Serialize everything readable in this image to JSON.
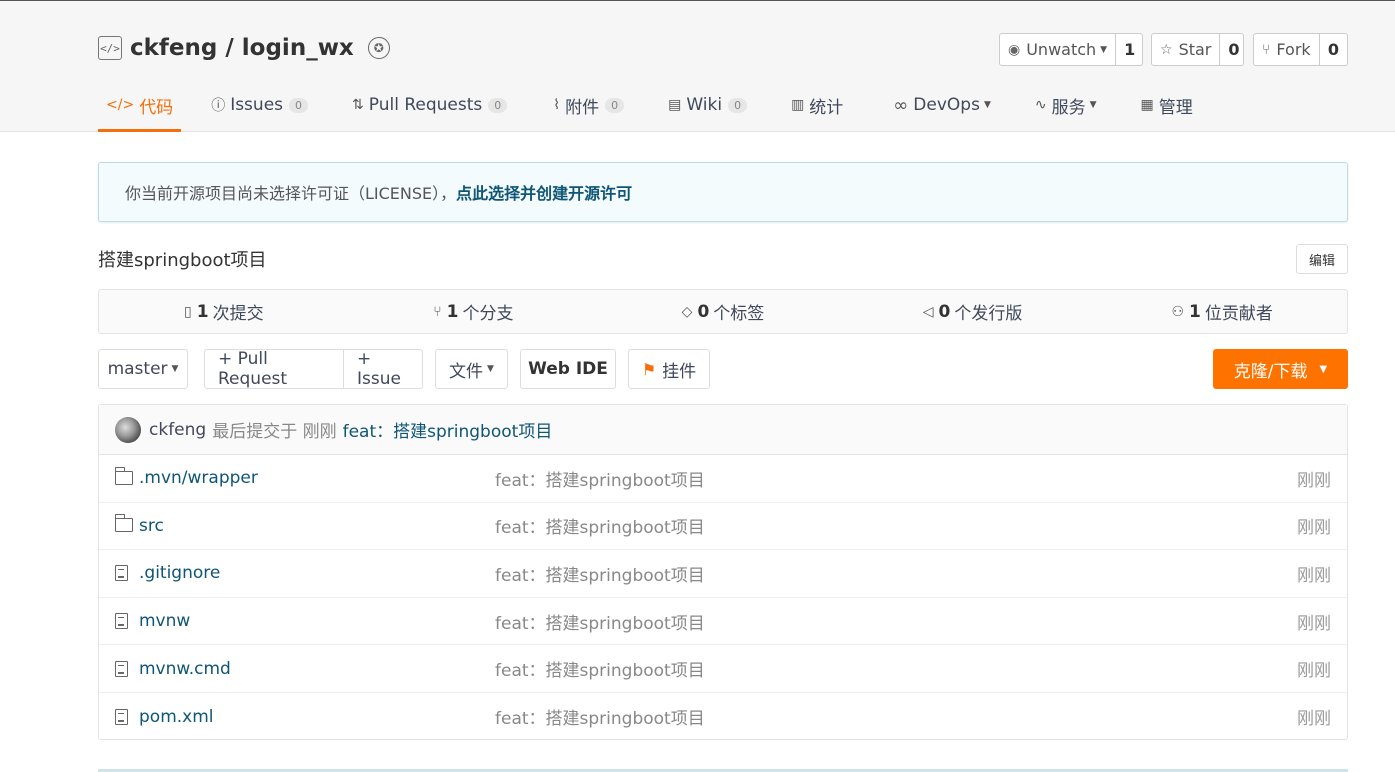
{
  "repo": {
    "owner": "ckfeng",
    "separator": "/",
    "name": "login_wx"
  },
  "actions": {
    "watch": {
      "label": "Unwatch",
      "count": "1"
    },
    "star": {
      "label": "Star",
      "count": "0"
    },
    "fork": {
      "label": "Fork",
      "count": "0"
    }
  },
  "tabs": [
    {
      "label": "代码",
      "icon": "code-icon"
    },
    {
      "label": "Issues",
      "count": "0",
      "icon": "issue-icon"
    },
    {
      "label": "Pull Requests",
      "count": "0",
      "icon": "pull-request-icon"
    },
    {
      "label": "附件",
      "count": "0",
      "icon": "paperclip-icon"
    },
    {
      "label": "Wiki",
      "count": "0",
      "icon": "book-icon"
    },
    {
      "label": "统计",
      "icon": "bar-chart-icon"
    },
    {
      "label": "DevOps",
      "icon": "infinity-icon"
    },
    {
      "label": "服务",
      "icon": "pulse-icon"
    },
    {
      "label": "管理",
      "icon": "settings-doc-icon"
    }
  ],
  "notice": {
    "text": "你当前开源项目尚未选择许可证（LICENSE），",
    "link": "点此选择并创建开源许可"
  },
  "description": "搭建springboot项目",
  "edit_label": "编辑",
  "stats": [
    {
      "count": "1",
      "label": "次提交",
      "icon": "commit-icon"
    },
    {
      "count": "1",
      "label": "个分支",
      "icon": "branch-icon"
    },
    {
      "count": "0",
      "label": "个标签",
      "icon": "tag-icon"
    },
    {
      "count": "0",
      "label": "个发行版",
      "icon": "release-icon"
    },
    {
      "count": "1",
      "label": "位贡献者",
      "icon": "contributors-icon"
    }
  ],
  "toolbar": {
    "branch": "master",
    "pull_request": "+ Pull Request",
    "issue": "+ Issue",
    "files": "文件",
    "web_ide": "Web IDE",
    "widget": "挂件",
    "clone": "克隆/下载"
  },
  "last_commit": {
    "author": "ckfeng",
    "meta": "最后提交于 刚刚",
    "message": "feat：搭建springboot项目"
  },
  "files": [
    {
      "name": ".mvn/wrapper",
      "type": "folder",
      "message": "feat：搭建springboot项目",
      "time": "刚刚"
    },
    {
      "name": "src",
      "type": "folder",
      "message": "feat：搭建springboot项目",
      "time": "刚刚"
    },
    {
      "name": ".gitignore",
      "type": "file",
      "message": "feat：搭建springboot项目",
      "time": "刚刚"
    },
    {
      "name": "mvnw",
      "type": "file",
      "message": "feat：搭建springboot项目",
      "time": "刚刚"
    },
    {
      "name": "mvnw.cmd",
      "type": "file",
      "message": "feat：搭建springboot项目",
      "time": "刚刚"
    },
    {
      "name": "pom.xml",
      "type": "file",
      "message": "feat：搭建springboot项目",
      "time": "刚刚"
    }
  ],
  "colors": {
    "accent": "#f66e0a",
    "clone_button": "#fe7300",
    "link": "#0f5575"
  }
}
